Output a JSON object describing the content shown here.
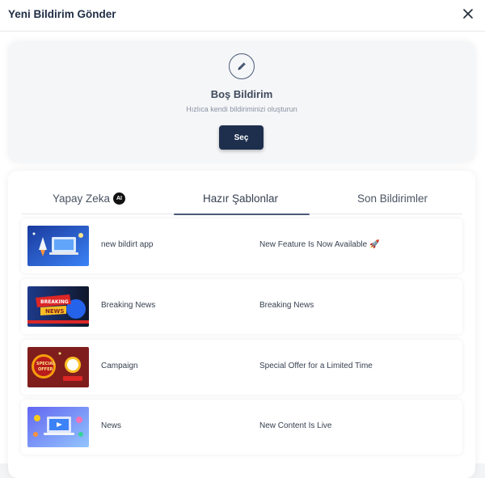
{
  "modal": {
    "title": "Yeni Bildirim Gönder"
  },
  "blank": {
    "title": "Boş Bildirim",
    "subtitle": "Hızlıca kendi bildiriminizi oluşturun",
    "button_label": "Seç"
  },
  "tabs": [
    {
      "label": "Yapay Zeka",
      "badge": "AI",
      "active": false
    },
    {
      "label": "Hazır Şablonlar",
      "active": true
    },
    {
      "label": "Son Bildirimler",
      "active": false
    }
  ],
  "templates": [
    {
      "name": "new bildirt app",
      "headline": "New Feature Is Now Available 🚀",
      "thumb_icon": "rocket-laptop-image"
    },
    {
      "name": "Breaking News",
      "headline": "Breaking News",
      "thumb_icon": "breaking-news-image"
    },
    {
      "name": "Campaign",
      "headline": "Special Offer for a Limited Time",
      "thumb_icon": "special-offer-image"
    },
    {
      "name": "News",
      "headline": "New Content Is Live",
      "thumb_icon": "laptop-content-image"
    }
  ],
  "colors": {
    "primary": "#1e2f4d",
    "tab_underline": "#4a5a78"
  }
}
